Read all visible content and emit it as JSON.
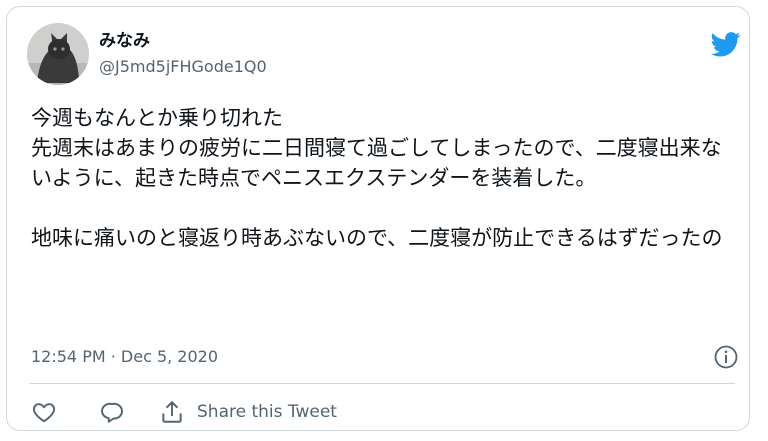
{
  "user": {
    "display_name": "みなみ",
    "handle": "@J5md5jFHGode1Q0"
  },
  "tweet": {
    "text": "今週もなんとか乗り切れた\n先週末はあまりの疲労に二日間寝て過ごしてしまったので、二度寝出来ないように、起きた時点でペニスエクステンダーを装着した。\n\n地味に痛いのと寝返り時あぶないので、二度寝が防止できるはずだったの",
    "timestamp": "12:54 PM · Dec 5, 2020"
  },
  "actions": {
    "share_label": "Share this Tweet"
  },
  "icons": {
    "brand": "twitter-bird-icon",
    "info": "info-icon",
    "like": "heart-icon",
    "reply": "reply-bubble-icon",
    "share": "share-icon"
  },
  "colors": {
    "brand": "#1d9bf0",
    "text": "#0f1419",
    "secondary": "#536471",
    "border": "#cfd9de"
  }
}
